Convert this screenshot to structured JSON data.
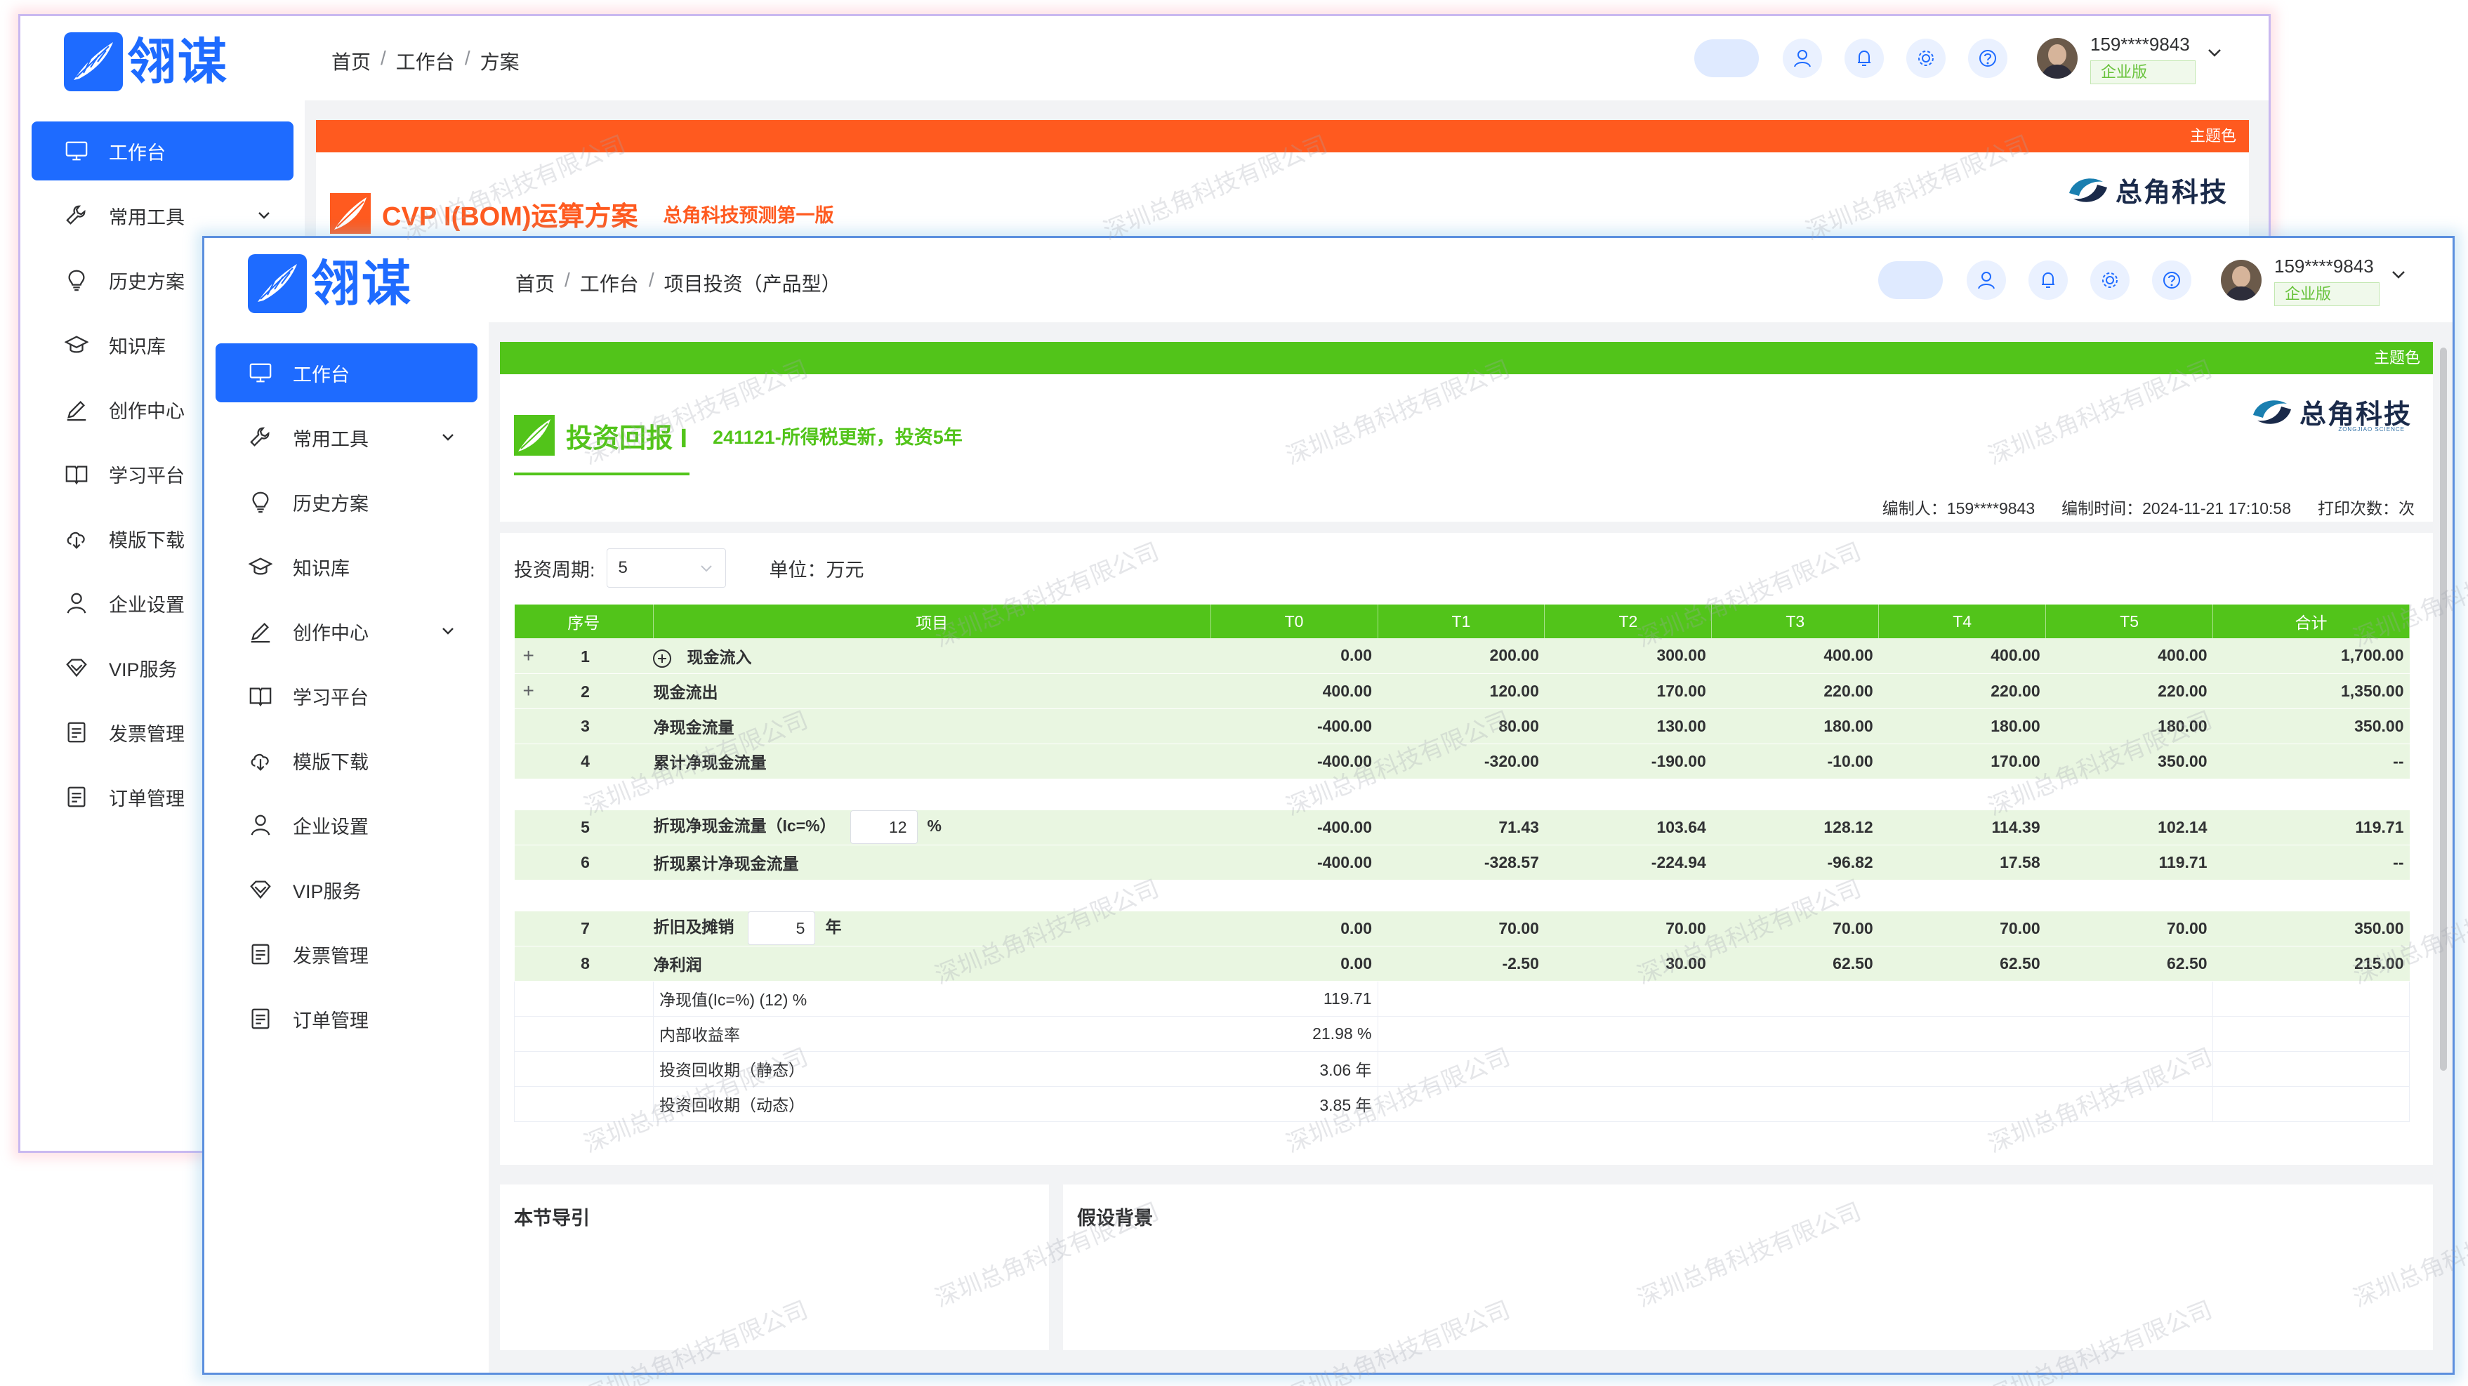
{
  "logo": {
    "text": "翎谋"
  },
  "brand": {
    "text": "总角科技",
    "sub": "ZONGJIAO SCIENCE"
  },
  "menu": [
    {
      "label": "工作台",
      "icon": "monitor-icon",
      "active": true
    },
    {
      "label": "常用工具",
      "icon": "wrench-icon",
      "has_arrow": true
    },
    {
      "label": "历史方案",
      "icon": "bulb-icon"
    },
    {
      "label": "知识库",
      "icon": "graduation-cap-icon"
    },
    {
      "label": "创作中心",
      "icon": "pen-icon",
      "has_arrow": true
    },
    {
      "label": "学习平台",
      "icon": "book-icon"
    },
    {
      "label": "模版下载",
      "icon": "cloud-download-icon"
    },
    {
      "label": "企业设置",
      "icon": "user-icon"
    },
    {
      "label": "VIP服务",
      "icon": "diamond-icon"
    },
    {
      "label": "发票管理",
      "icon": "document-icon"
    },
    {
      "label": "订单管理",
      "icon": "document-icon"
    }
  ],
  "user": {
    "name": "159****9843",
    "badge": "企业版"
  },
  "theme_label": "主题色",
  "watermark_text": "深圳总角科技有限公司",
  "back_window": {
    "breadcrumb": [
      "首页",
      "工作台",
      "方案"
    ],
    "title": "CVP I(BOM)运算方案",
    "subtitle": "总角科技预测第一版"
  },
  "front_window": {
    "breadcrumb": [
      "首页",
      "工作台",
      "项目投资（产品型）"
    ],
    "title": "投资回报 I",
    "subtitle": "241121-所得税更新，投资5年",
    "meta": {
      "editor": "编制人：159****9843",
      "time": "编制时间：2024-11-21 17:10:58",
      "print": "打印次数：次"
    },
    "filter": {
      "period_label": "投资周期:",
      "period_value": "5",
      "unit": "单位：万元"
    },
    "table": {
      "headers": [
        "序号",
        "项目",
        "T0",
        "T1",
        "T2",
        "T3",
        "T4",
        "T5",
        "合计"
      ],
      "rows": [
        {
          "idx": "1",
          "expand": "+",
          "circle": true,
          "name": "现金流入",
          "values": [
            "0.00",
            "200.00",
            "300.00",
            "400.00",
            "400.00",
            "400.00",
            "1,700.00"
          ]
        },
        {
          "idx": "2",
          "expand": "+",
          "name": "现金流出",
          "values": [
            "400.00",
            "120.00",
            "170.00",
            "220.00",
            "220.00",
            "220.00",
            "1,350.00"
          ]
        },
        {
          "idx": "3",
          "name": "净现金流量",
          "values": [
            "-400.00",
            "80.00",
            "130.00",
            "180.00",
            "180.00",
            "180.00",
            "350.00"
          ]
        },
        {
          "idx": "4",
          "name": "累计净现金流量",
          "values": [
            "-400.00",
            "-320.00",
            "-190.00",
            "-10.00",
            "170.00",
            "350.00",
            "--"
          ]
        },
        {
          "idx": "5",
          "name": "折现净现金流量（Ic=%）",
          "input": "12",
          "suffix": "%",
          "values": [
            "-400.00",
            "71.43",
            "103.64",
            "128.12",
            "114.39",
            "102.14",
            "119.71"
          ]
        },
        {
          "idx": "6",
          "name": "折现累计净现金流量",
          "values": [
            "-400.00",
            "-328.57",
            "-224.94",
            "-96.82",
            "17.58",
            "119.71",
            "--"
          ]
        },
        {
          "idx": "7",
          "name": "折旧及摊销",
          "input": "5",
          "suffix": "年",
          "values": [
            "0.00",
            "70.00",
            "70.00",
            "70.00",
            "70.00",
            "70.00",
            "350.00"
          ]
        },
        {
          "idx": "8",
          "name": "净利润",
          "values": [
            "0.00",
            "-2.50",
            "30.00",
            "62.50",
            "62.50",
            "62.50",
            "215.00"
          ]
        }
      ],
      "summary": [
        {
          "label": "净现值(Ic=%) (12) %",
          "value": "119.71"
        },
        {
          "label": "内部收益率",
          "value": "21.98 %"
        },
        {
          "label": "投资回收期（静态）",
          "value": "3.06 年"
        },
        {
          "label": "投资回收期（动态）",
          "value": "3.85 年"
        }
      ]
    },
    "bottom": {
      "guide": "本节导引",
      "assumption": "假设背景"
    }
  }
}
